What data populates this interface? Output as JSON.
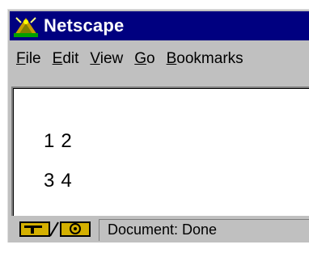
{
  "window": {
    "title": "Netscape"
  },
  "menubar": {
    "items": [
      {
        "accel": "F",
        "rest": "ile"
      },
      {
        "accel": "E",
        "rest": "dit"
      },
      {
        "accel": "V",
        "rest": "iew"
      },
      {
        "accel": "G",
        "rest": "o"
      },
      {
        "accel": "B",
        "rest": "ookmarks"
      }
    ]
  },
  "content": {
    "rows": [
      [
        "1",
        "2"
      ],
      [
        "3",
        "4"
      ]
    ]
  },
  "status": {
    "text": "Document: Done"
  },
  "colors": {
    "titlebar": "#000080",
    "chrome": "#c0c0c0",
    "content": "#ffffff"
  }
}
